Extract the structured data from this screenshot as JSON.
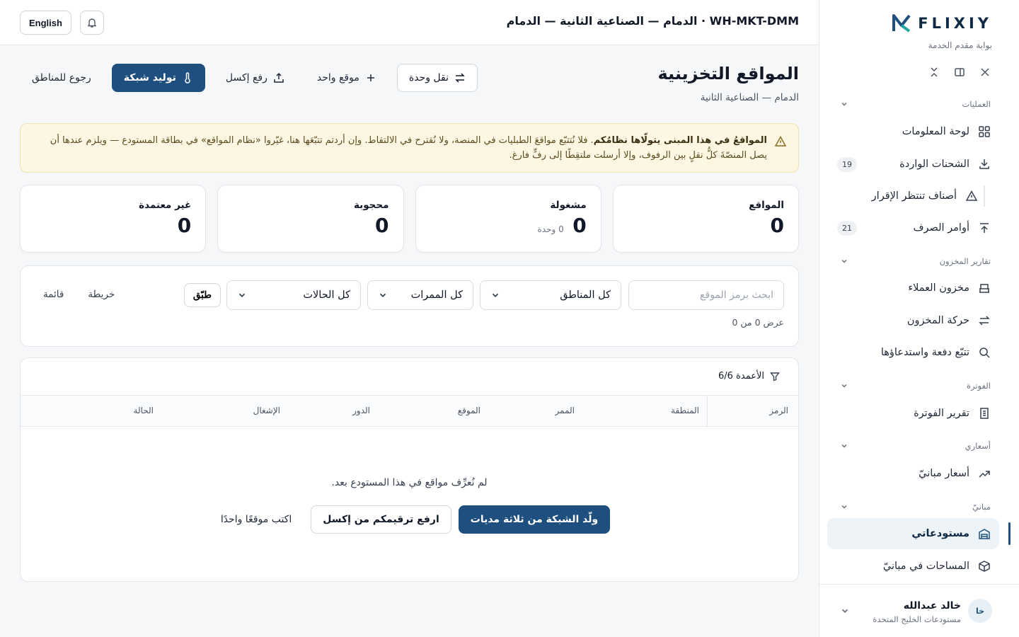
{
  "brand": {
    "name": "FLIXIY",
    "subtitle": "بوابة مقدم الخدمة"
  },
  "topbar": {
    "breadcrumb": "WH-MKT-DMM · الدمام — الصناعية الثانية — الدمام",
    "language_label": "English"
  },
  "sidebar": {
    "sections": [
      {
        "title": "العمليات",
        "items": [
          {
            "label": "لوحة المعلومات",
            "icon": "grid-icon"
          },
          {
            "label": "الشحنات الواردة",
            "icon": "download-icon",
            "badge": "19"
          },
          {
            "label": "أصناف تنتظر الإقرار",
            "icon": "alert-triangle-icon"
          },
          {
            "label": "أوامر الصرف",
            "icon": "upload-icon",
            "badge": "21"
          }
        ]
      },
      {
        "title": "تقارير المخزون",
        "items": [
          {
            "label": "مخزون العملاء",
            "icon": "shelves-icon"
          },
          {
            "label": "حركة المخزون",
            "icon": "swap-icon"
          },
          {
            "label": "تتبّع دفعة واستدعاؤها",
            "icon": "search-icon"
          }
        ]
      },
      {
        "title": "الفوترة",
        "items": [
          {
            "label": "تقرير الفوترة",
            "icon": "receipt-icon"
          }
        ]
      },
      {
        "title": "أسعاري",
        "items": [
          {
            "label": "أسعار مبانيّ",
            "icon": "trending-up-icon"
          }
        ]
      },
      {
        "title": "مبانيّ",
        "items": [
          {
            "label": "مستودعاتي",
            "icon": "warehouse-icon",
            "active": true
          },
          {
            "label": "المساحات في مبانيّ",
            "icon": "box-icon"
          }
        ]
      }
    ],
    "profile": {
      "initials": "خا",
      "name": "خالد عبدالله",
      "org": "مستودعات الخليج المتحدة"
    }
  },
  "page": {
    "title": "المواقع التخزينية",
    "subtitle": "الدمام — الصناعية الثانية",
    "actions": {
      "back": "رجوع للمناطق",
      "generate": "توليد شبكة",
      "upload": "رفع إكسل",
      "single": "موقع واحد",
      "move": "نقل وحدة"
    },
    "alert": {
      "bold": "المواقعُ في هذا المبنى يتولّاها نظامُكم",
      "text": ". فلا نُتتبّع مواقعَ الطبليات في المنصة، ولا نُقترح في الالتقاط. وإن أردتم تتبّعَها هنا، غيّروا «نظام المواقع» في بطاقة المستودع — ويلزم عندها أن يصل المنصّةَ كلُّ نقلٍ بين الرفوف، وإلا أرسلت ملتقِطًا إلى رفٍّ فارغ."
    },
    "stats": [
      {
        "label": "المواقع",
        "value": "0"
      },
      {
        "label": "مشغولة",
        "value": "0",
        "note": "0 وحدة"
      },
      {
        "label": "محجوبة",
        "value": "0"
      },
      {
        "label": "غير معتمدة",
        "value": "0"
      }
    ],
    "filters": {
      "search_placeholder": "ابحث برمز الموقع",
      "zones": "كل المناطق",
      "aisles": "كل الممرات",
      "statuses": "كل الحالات",
      "apply": "طبّق",
      "view_map": "خريطة",
      "view_list": "قائمة",
      "count": "عرض 0 من 0"
    },
    "table": {
      "columns_toggle": "الأعمدة 6/6",
      "columns": [
        "الرمز",
        "المنطقة",
        "الممر",
        "الموقع",
        "الدور",
        "الإشغال",
        "الحالة"
      ],
      "empty_message": "لم نُعرِّف مواقع في هذا المستودع بعد.",
      "empty_generate": "ولّد الشبكة من ثلاثة مديات",
      "empty_upload": "ارفع ترقيمكم من إكسل",
      "empty_single": "اكتب موقعًا واحدًا"
    }
  },
  "colors": {
    "primary": "#1e4f7e",
    "alert_bg": "#fdf6e3",
    "page_bg": "#f6f7f9"
  }
}
